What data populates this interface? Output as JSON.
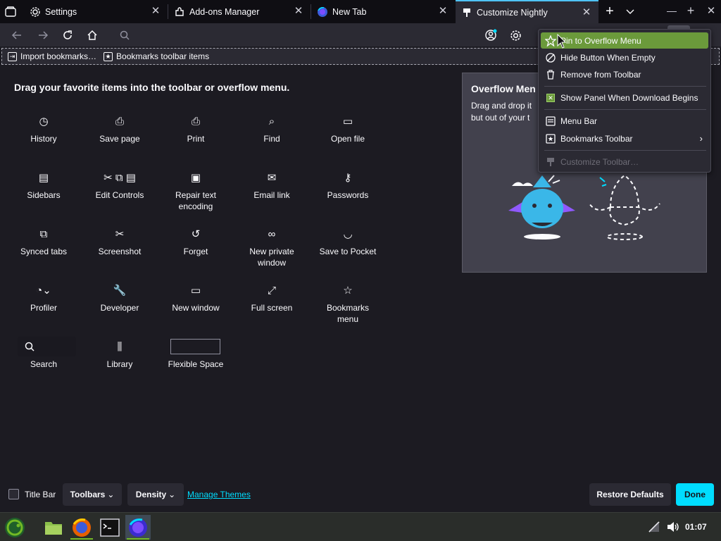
{
  "tabs": [
    {
      "label": "Settings",
      "icon": "gear-icon"
    },
    {
      "label": "Add-ons Manager",
      "icon": "puzzle-icon"
    },
    {
      "label": "New Tab",
      "icon": "firefox-icon"
    },
    {
      "label": "Customize Nightly",
      "icon": "brush-icon",
      "selected": true
    }
  ],
  "bookmarks_toolbar": {
    "import_label": "Import bookmarks…",
    "items_label": "Bookmarks toolbar items"
  },
  "palette": {
    "heading": "Drag your favorite items into the toolbar or overflow menu.",
    "items": [
      {
        "label": "History",
        "icon": "clock-icon",
        "glyph": "◷"
      },
      {
        "label": "Save page",
        "icon": "save-page-icon",
        "glyph": "⎙"
      },
      {
        "label": "Print",
        "icon": "printer-icon",
        "glyph": "⎙"
      },
      {
        "label": "Find",
        "icon": "magnifier-icon",
        "glyph": "⌕"
      },
      {
        "label": "Open file",
        "icon": "folder-icon",
        "glyph": "▭"
      },
      {
        "label": "Sidebars",
        "icon": "sidebar-icon",
        "glyph": "▤"
      },
      {
        "label": "Edit Controls",
        "icon": "scissors-copy-paste-icon",
        "glyph": "✂ ⧉ ▤"
      },
      {
        "label": "Repair text encoding",
        "icon": "text-encoding-icon",
        "glyph": "▣"
      },
      {
        "label": "Email link",
        "icon": "envelope-icon",
        "glyph": "✉"
      },
      {
        "label": "Passwords",
        "icon": "key-icon",
        "glyph": "⚷"
      },
      {
        "label": "Synced tabs",
        "icon": "synced-tabs-icon",
        "glyph": "⧉"
      },
      {
        "label": "Screenshot",
        "icon": "screenshot-icon",
        "glyph": "✂"
      },
      {
        "label": "Forget",
        "icon": "forget-icon",
        "glyph": "↺"
      },
      {
        "label": "New private window",
        "icon": "private-mask-icon",
        "glyph": "∞"
      },
      {
        "label": "Save to Pocket",
        "icon": "pocket-icon",
        "glyph": "◡"
      },
      {
        "label": "Profiler",
        "icon": "profiler-gauge-icon",
        "glyph": "◔⌄"
      },
      {
        "label": "Developer",
        "icon": "wrench-icon",
        "glyph": "🔧"
      },
      {
        "label": "New window",
        "icon": "window-icon",
        "glyph": "▭"
      },
      {
        "label": "Full screen",
        "icon": "expand-arrows-icon",
        "glyph": "⤢"
      },
      {
        "label": "Bookmarks menu",
        "icon": "bookmark-star-icon",
        "glyph": "☆"
      },
      {
        "label": "Search",
        "icon": "search-field-icon",
        "glyph": "⌕"
      },
      {
        "label": "Library",
        "icon": "library-icon",
        "glyph": "⫼"
      },
      {
        "label": "Flexible Space",
        "icon": "flexible-space-icon",
        "glyph": ""
      }
    ]
  },
  "overflow_panel": {
    "title": "Overflow Men",
    "description_line1": "Drag and drop it",
    "description_line2": "but out of your t"
  },
  "context_menu": {
    "items": [
      {
        "label": "Pin to Overflow Menu",
        "icon": "pin-icon"
      },
      {
        "label": "Hide Button When Empty",
        "icon": "hide-icon"
      },
      {
        "label": "Remove from Toolbar",
        "icon": "trash-icon"
      },
      {
        "label": "Show Panel When Download Begins",
        "icon": "checkbox-checked-icon"
      },
      {
        "label": "Menu Bar",
        "icon": "menu-bar-icon"
      },
      {
        "label": "Bookmarks Toolbar",
        "icon": "bookmarks-toolbar-icon"
      },
      {
        "label": "Customize Toolbar…",
        "icon": "customize-icon"
      }
    ]
  },
  "bottom_bar": {
    "title_bar_label": "Title Bar",
    "toolbars_label": "Toolbars",
    "density_label": "Density",
    "manage_themes_label": "Manage Themes",
    "restore_label": "Restore Defaults",
    "done_label": "Done"
  },
  "taskbar": {
    "time": "01:07"
  },
  "colors": {
    "accent": "#00ddff",
    "menu_highlight": "#6b9a3b",
    "link": "#00ddff"
  }
}
